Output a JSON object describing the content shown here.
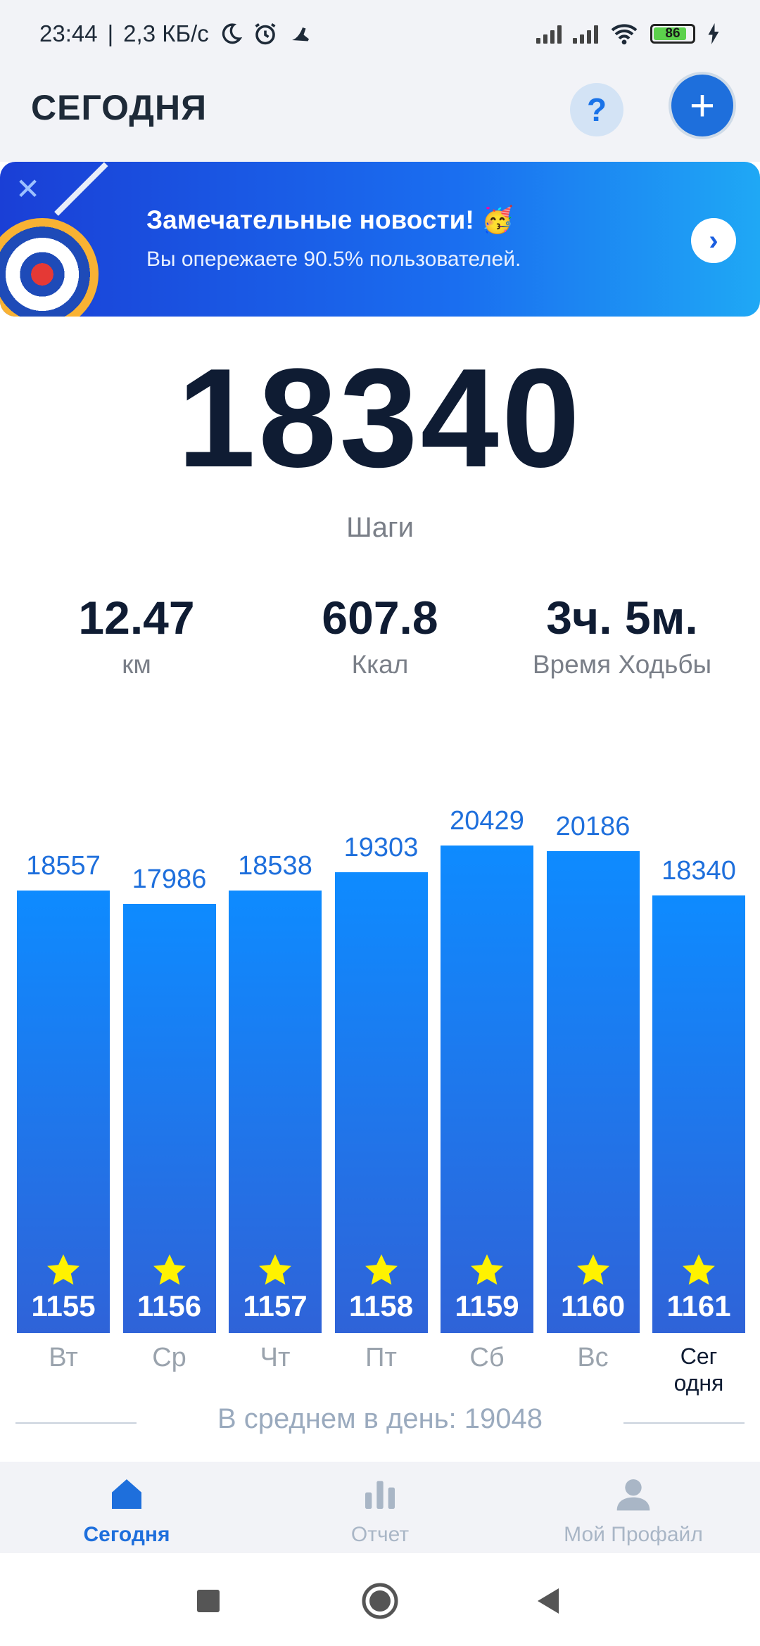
{
  "status_bar": {
    "time": "23:44",
    "speed": "2,3 КБ/с",
    "battery": "86"
  },
  "header": {
    "title": "СЕГОДНЯ",
    "help": "?",
    "add": "+"
  },
  "banner": {
    "title": "Замечательные новости! 🥳",
    "subtitle": "Вы опережаете 90.5% пользователей.",
    "close": "✕",
    "arrow": "›"
  },
  "summary": {
    "steps": "18340",
    "steps_label": "Шаги",
    "distance": {
      "value": "12.47",
      "unit": "км"
    },
    "calories": {
      "value": "607.8",
      "unit": "Ккал"
    },
    "time": {
      "value": "3ч. 5м.",
      "unit": "Время Ходьбы"
    }
  },
  "chart_data": {
    "type": "bar",
    "categories": [
      "Вт",
      "Ср",
      "Чт",
      "Пт",
      "Сб",
      "Вс",
      "Сег одня"
    ],
    "values": [
      18557,
      17986,
      18538,
      19303,
      20429,
      20186,
      18340
    ],
    "value_labels": [
      "18557",
      "17986",
      "18538",
      "19303",
      "20429",
      "20186",
      "18340"
    ],
    "badges": [
      "1155",
      "1156",
      "1157",
      "1158",
      "1159",
      "1160",
      "1161"
    ],
    "day_labels": [
      "Вт",
      "Ср",
      "Чт",
      "Пт",
      "Сб",
      "Вс",
      "Сег\nодня"
    ],
    "ylim": [
      0,
      20429
    ],
    "colors": {
      "bar_top": "#0e8bff",
      "bar_bottom": "#2f63d8",
      "value": "#1e6fdc",
      "star": "#fff200"
    }
  },
  "average": {
    "text": "В среднем в день: 19048"
  },
  "bottom_nav": [
    {
      "label": "Сегодня",
      "icon": "home-icon",
      "active": true
    },
    {
      "label": "Отчет",
      "icon": "bar-chart-icon",
      "active": false
    },
    {
      "label": "Мой Профайл",
      "icon": "profile-icon",
      "active": false
    }
  ]
}
